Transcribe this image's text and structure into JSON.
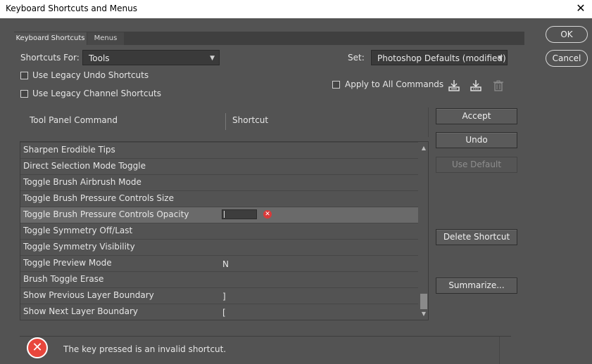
{
  "window": {
    "title": "Keyboard Shortcuts and Menus",
    "close_glyph": "✕"
  },
  "tabs": [
    {
      "label": "Keyboard Shortcuts",
      "active": true
    },
    {
      "label": "Menus",
      "active": false
    }
  ],
  "controls": {
    "shortcuts_for_label": "Shortcuts For:",
    "shortcuts_for_value": "Tools",
    "set_label": "Set:",
    "set_value": "Photoshop Defaults (modified)",
    "legacy_undo_label": "Use Legacy Undo Shortcuts",
    "legacy_undo_checked": false,
    "legacy_channel_label": "Use Legacy Channel Shortcuts",
    "legacy_channel_checked": false,
    "apply_all_label": "Apply to All Commands",
    "apply_all_checked": false
  },
  "icons": {
    "save_set": "save-set-icon",
    "save_set_as": "save-set-as-icon",
    "delete_set": "trash-icon"
  },
  "table": {
    "col_command": "Tool Panel Command",
    "col_shortcut": "Shortcut",
    "rows": [
      {
        "command": "Sharpen Erodible Tips",
        "shortcut": ""
      },
      {
        "command": "Direct Selection Mode Toggle",
        "shortcut": ""
      },
      {
        "command": "Toggle Brush Airbrush Mode",
        "shortcut": ""
      },
      {
        "command": "Toggle Brush Pressure Controls Size",
        "shortcut": ""
      },
      {
        "command": "Toggle Brush Pressure Controls Opacity",
        "shortcut": "",
        "selected": true,
        "editing": true
      },
      {
        "command": "Toggle Symmetry Off/Last",
        "shortcut": ""
      },
      {
        "command": "Toggle Symmetry Visibility",
        "shortcut": ""
      },
      {
        "command": "Toggle Preview Mode",
        "shortcut": "N"
      },
      {
        "command": "Brush Toggle Erase",
        "shortcut": ""
      },
      {
        "command": "Show Previous Layer Boundary",
        "shortcut": "]"
      },
      {
        "command": "Show Next Layer Boundary",
        "shortcut": "["
      }
    ]
  },
  "buttons": {
    "ok": "OK",
    "cancel": "Cancel",
    "accept": "Accept",
    "undo": "Undo",
    "use_default": "Use Default",
    "delete_shortcut": "Delete Shortcut",
    "summarize": "Summarize..."
  },
  "message": {
    "text": "The key pressed is an invalid shortcut.",
    "icon": "error-icon"
  },
  "colors": {
    "background": "#535353",
    "error": "#e8463c",
    "selected_row": "#6a6a6a"
  }
}
